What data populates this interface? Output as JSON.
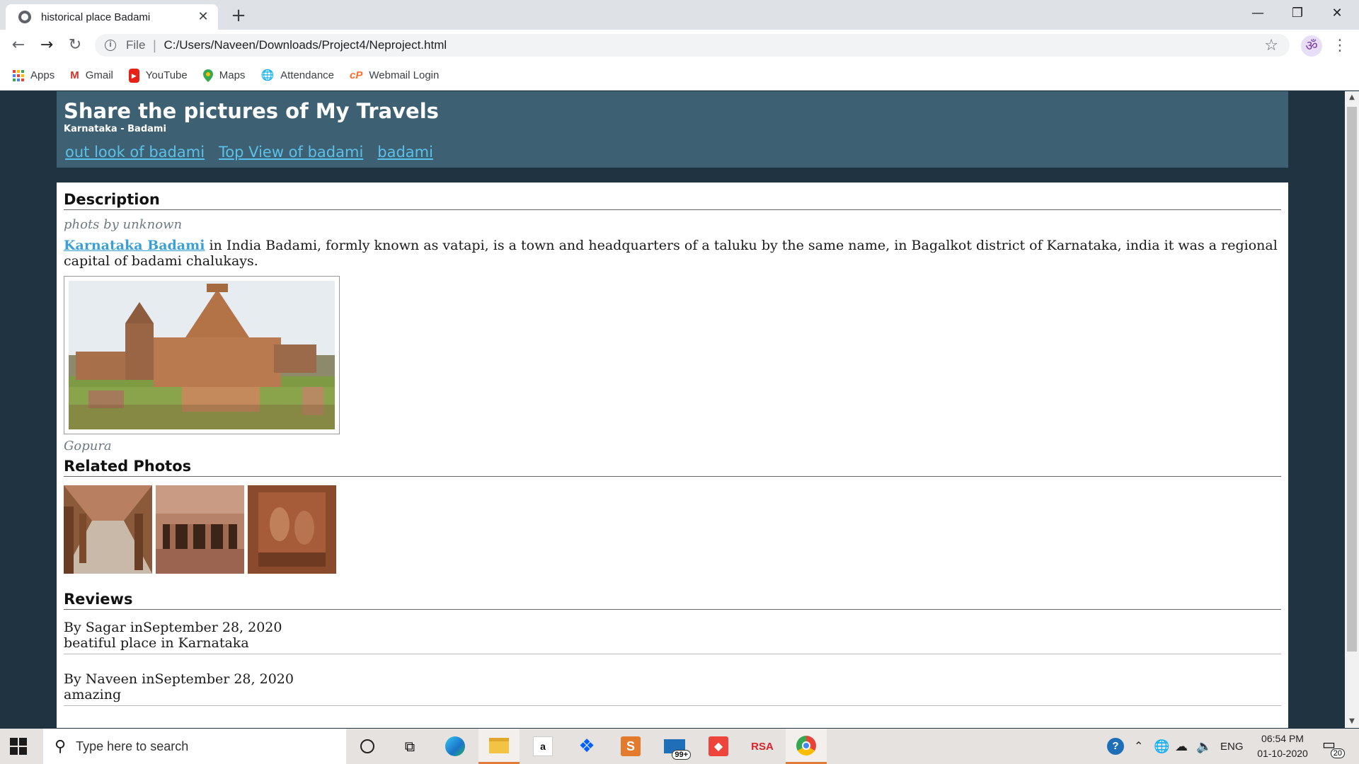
{
  "browser": {
    "tab_title": "historical place Badami",
    "scheme": "File",
    "url": "C:/Users/Naveen/Downloads/Project4/Neproject.html",
    "profile_glyph": "ॐ",
    "bookmarks": [
      {
        "label": "Apps",
        "icon": "apps-grid-icon"
      },
      {
        "label": "Gmail",
        "icon": "gmail-icon"
      },
      {
        "label": "YouTube",
        "icon": "youtube-icon"
      },
      {
        "label": "Maps",
        "icon": "maps-pin-icon"
      },
      {
        "label": "Attendance",
        "icon": "globe-icon"
      },
      {
        "label": "Webmail Login",
        "icon": "cpanel-icon"
      }
    ]
  },
  "page": {
    "title": "Share the pictures of My Travels",
    "subtitle": "Karnataka - Badami",
    "nav": [
      "out look of badami",
      "Top View of badami",
      "badami"
    ],
    "description_heading": "Description",
    "photo_credit": "phots by unknown",
    "intro_link": "Karnataka Badami",
    "intro_text": " in India Badami, formly known as vatapi, is a town and headquarters of a taluku by the same name, in Bagalkot district of Karnataka, india it was a regional capital of badami chalukays.",
    "figure_caption": "Gopura",
    "related_heading": "Related Photos",
    "reviews_heading": "Reviews",
    "reviews": [
      {
        "meta": "By Sagar inSeptember 28, 2020",
        "text": "beatiful place in Karnataka"
      },
      {
        "meta": "By Naveen inSeptember 28, 2020",
        "text": "amazing"
      }
    ]
  },
  "taskbar": {
    "search_placeholder": "Type here to search",
    "mail_badge": "99+",
    "rsa_label": "RSA",
    "amazon_label": "a",
    "language": "ENG",
    "time": "06:54 PM",
    "date": "01-10-2020",
    "notification_count": "20"
  }
}
